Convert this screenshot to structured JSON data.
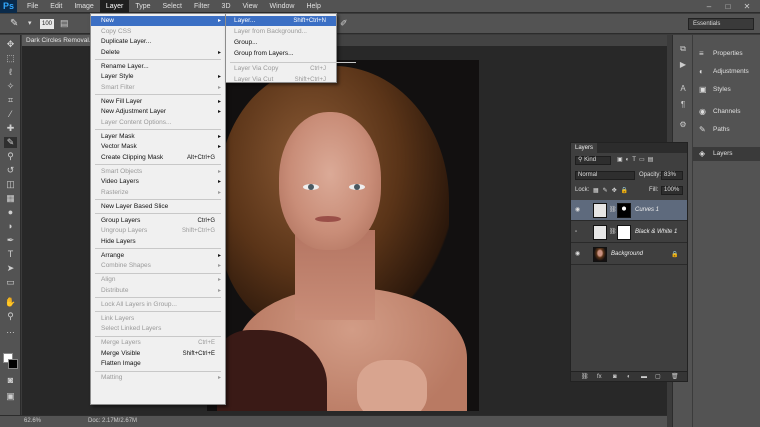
{
  "app": {
    "logo": "Ps"
  },
  "menubar": {
    "items": [
      "File",
      "Edit",
      "Image",
      "Layer",
      "Type",
      "Select",
      "Filter",
      "3D",
      "View",
      "Window",
      "Help"
    ],
    "active_index": 3
  },
  "window_controls": {
    "minimize": "–",
    "restore": "□",
    "close": "✕"
  },
  "options_bar": {
    "brush_size": "100",
    "workspace": "Essentials"
  },
  "document": {
    "tab_title": "Dark Circles Removal..."
  },
  "status": {
    "zoom": "62.6%",
    "doc_size": "Doc: 2.17M/2.67M"
  },
  "layer_menu": {
    "items": [
      {
        "label": "New",
        "submenu": true,
        "highlight": true
      },
      {
        "label": "Copy CSS",
        "disabled": true
      },
      {
        "label": "Duplicate Layer..."
      },
      {
        "label": "Delete",
        "submenu": true
      },
      {
        "sep": true
      },
      {
        "label": "Rename Layer..."
      },
      {
        "label": "Layer Style",
        "submenu": true
      },
      {
        "label": "Smart Filter",
        "submenu": true,
        "disabled": true
      },
      {
        "sep": true
      },
      {
        "label": "New Fill Layer",
        "submenu": true
      },
      {
        "label": "New Adjustment Layer",
        "submenu": true
      },
      {
        "label": "Layer Content Options...",
        "disabled": true
      },
      {
        "sep": true
      },
      {
        "label": "Layer Mask",
        "submenu": true
      },
      {
        "label": "Vector Mask",
        "submenu": true
      },
      {
        "label": "Create Clipping Mask",
        "shortcut": "Alt+Ctrl+G"
      },
      {
        "sep": true
      },
      {
        "label": "Smart Objects",
        "submenu": true,
        "disabled": true
      },
      {
        "label": "Video Layers",
        "submenu": true
      },
      {
        "label": "Rasterize",
        "submenu": true,
        "disabled": true
      },
      {
        "sep": true
      },
      {
        "label": "New Layer Based Slice"
      },
      {
        "sep": true
      },
      {
        "label": "Group Layers",
        "shortcut": "Ctrl+G"
      },
      {
        "label": "Ungroup Layers",
        "shortcut": "Shift+Ctrl+G",
        "disabled": true
      },
      {
        "label": "Hide Layers"
      },
      {
        "sep": true
      },
      {
        "label": "Arrange",
        "submenu": true
      },
      {
        "label": "Combine Shapes",
        "submenu": true,
        "disabled": true
      },
      {
        "sep": true
      },
      {
        "label": "Align",
        "submenu": true,
        "disabled": true
      },
      {
        "label": "Distribute",
        "submenu": true,
        "disabled": true
      },
      {
        "sep": true
      },
      {
        "label": "Lock All Layers in Group...",
        "disabled": true
      },
      {
        "sep": true
      },
      {
        "label": "Link Layers",
        "disabled": true
      },
      {
        "label": "Select Linked Layers",
        "disabled": true
      },
      {
        "sep": true
      },
      {
        "label": "Merge Layers",
        "shortcut": "Ctrl+E",
        "disabled": true
      },
      {
        "label": "Merge Visible",
        "shortcut": "Shift+Ctrl+E"
      },
      {
        "label": "Flatten Image"
      },
      {
        "sep": true
      },
      {
        "label": "Matting",
        "submenu": true,
        "disabled": true
      }
    ]
  },
  "new_submenu": {
    "items": [
      {
        "label": "Layer...",
        "shortcut": "Shift+Ctrl+N",
        "highlight": true
      },
      {
        "label": "Layer from Background...",
        "disabled": true
      },
      {
        "label": "Group..."
      },
      {
        "label": "Group from Layers..."
      },
      {
        "sep": true
      },
      {
        "label": "Layer Via Copy",
        "shortcut": "Ctrl+J",
        "disabled": true
      },
      {
        "label": "Layer Via Cut",
        "shortcut": "Shift+Ctrl+J",
        "disabled": true
      }
    ]
  },
  "right_panels": [
    {
      "label": "Properties",
      "icon": "properties-icon",
      "glyph": "≡"
    },
    {
      "label": "Adjustments",
      "icon": "adjustments-icon",
      "glyph": "◐"
    },
    {
      "label": "Styles",
      "icon": "styles-icon",
      "glyph": "▣"
    },
    {
      "label": "Channels",
      "icon": "channels-icon",
      "glyph": "◉"
    },
    {
      "label": "Paths",
      "icon": "paths-icon",
      "glyph": "✎"
    },
    {
      "label": "Layers",
      "icon": "layers-icon",
      "glyph": "◈",
      "active": true
    }
  ],
  "layers_panel": {
    "tab": "Layers",
    "filter_label": "Kind",
    "blend_mode": "Normal",
    "opacity_label": "Opacity:",
    "opacity": "83%",
    "lock_label": "Lock:",
    "fill_label": "Fill:",
    "fill": "100%",
    "layers": [
      {
        "name": "Curves 1",
        "visible": true,
        "selected": true,
        "type": "adjustment"
      },
      {
        "name": "Black & White 1",
        "visible": false,
        "selected": false,
        "type": "adjustment"
      },
      {
        "name": "Background",
        "visible": true,
        "selected": false,
        "type": "pixel",
        "locked": true
      }
    ],
    "footer_icons": [
      "link-icon",
      "fx-icon",
      "mask-icon",
      "adjustment-icon",
      "group-icon",
      "new-layer-icon",
      "trash-icon"
    ]
  },
  "colors": {
    "menu_highlight": "#3b6fc4",
    "selected_layer": "#5e6a7d"
  }
}
